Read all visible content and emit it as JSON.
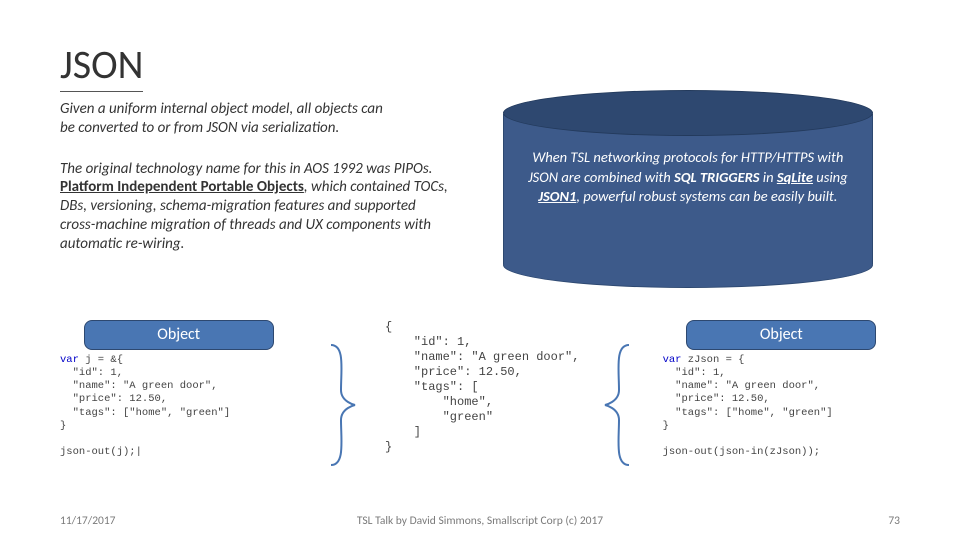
{
  "title": "JSON",
  "intro_line1": "Given a uniform internal object model, all objects can",
  "intro_line2": "be converted to or from JSON via serialization",
  "history_pre": "The original technology name for this in AOS 1992 was PIPOs. ",
  "history_underlined": "Platform Independent Portable Objects",
  "history_post": ", which contained TOCs, DBs, versioning, schema-migration features and supported cross-machine migration of threads and UX components with automatic re-wiring.",
  "cylinder": {
    "prefix": "When TSL networking protocols for HTTP/HTTPS with JSON are combined with ",
    "sql": "SQL TRIGGERS",
    "in_": " in ",
    "sqlite": "SqLite",
    "using_": " using ",
    "json1": "JSON1",
    "suffix": ", powerful robust systems can be easily built."
  },
  "object_label_left": "Object",
  "object_label_right": "Object",
  "code": {
    "left": "var j = &{\n  \"id\": 1,\n  \"name\": \"A green door\",\n  \"price\": 12.50,\n  \"tags\": [\"home\", \"green\"]\n}\n\njson-out(j);|",
    "middle": "{\n    \"id\": 1,\n    \"name\": \"A green door\",\n    \"price\": 12.50,\n    \"tags\": [\n        \"home\",\n        \"green\"\n    ]\n}",
    "right": "var zJson = {\n  \"id\": 1,\n  \"name\": \"A green door\",\n  \"price\": 12.50,\n  \"tags\": [\"home\", \"green\"]\n}\n\njson-out(json-in(zJson));"
  },
  "footer": {
    "date": "11/17/2017",
    "center": "TSL Talk by David Simmons, Smallscript Corp (c) 2017",
    "page": "73"
  }
}
